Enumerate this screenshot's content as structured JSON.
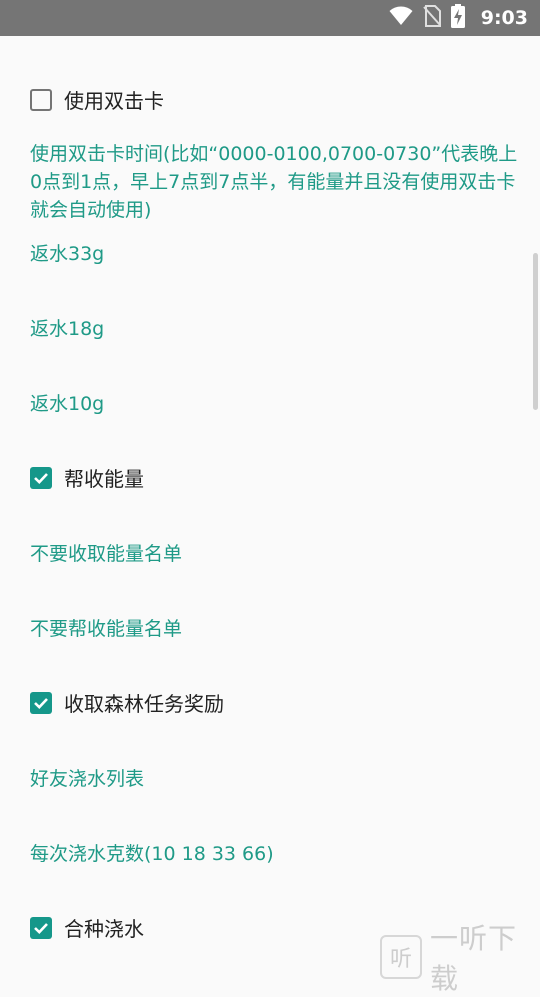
{
  "status_bar": {
    "time": "9:03",
    "icons": [
      "wifi-icon",
      "no-sim-icon",
      "battery-charging-icon"
    ]
  },
  "colors": {
    "accent": "#15978a",
    "link_text": "#1f9a87",
    "status_bar": "#757575",
    "background": "#fafafa"
  },
  "settings": {
    "double_click_card": {
      "label": "使用双击卡",
      "checked": false
    },
    "double_click_time_desc": "使用双击卡时间(比如“0000-0100,0700-0730”代表晚上0点到1点，早上7点到7点半，有能量并且没有使用双击卡就会自动使用)",
    "return_33": "返水33g",
    "return_18": "返水18g",
    "return_10": "返水10g",
    "help_collect": {
      "label": "帮收能量",
      "checked": true
    },
    "no_collect_list": "不要收取能量名单",
    "no_help_list": "不要帮收能量名单",
    "forest_task": {
      "label": "收取森林任务奖励",
      "checked": true
    },
    "friend_water_list": "好友浇水列表",
    "water_grams": "每次浇水克数(10 18 33 66)",
    "cooperate_water": {
      "label": "合种浇水",
      "checked": true
    }
  },
  "watermark": {
    "icon_char": "听",
    "text": "一听下载"
  }
}
